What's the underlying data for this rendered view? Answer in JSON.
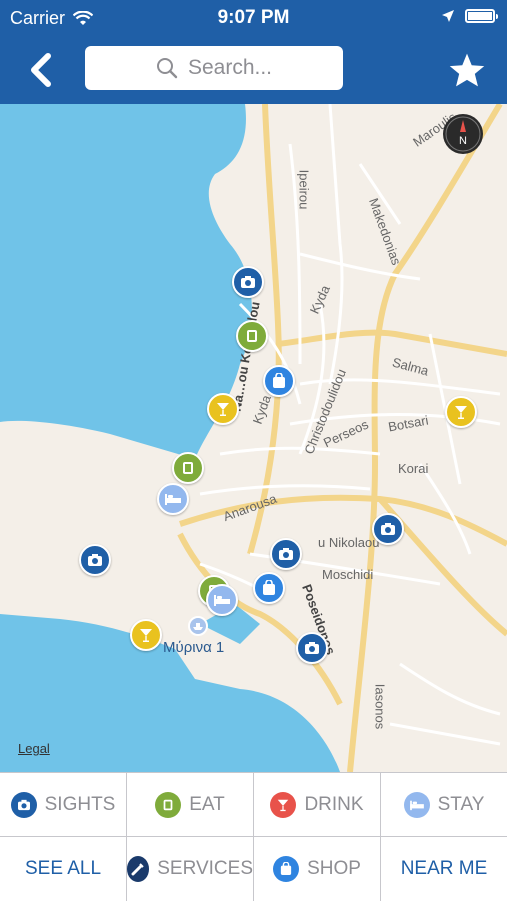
{
  "status_bar": {
    "carrier": "Carrier",
    "time": "9:07 PM"
  },
  "nav": {
    "search_placeholder": "Search..."
  },
  "map": {
    "legal": "Legal",
    "town_label": "Μύρινα 1",
    "street_labels": [
      "Ipeirou",
      "Makedonias",
      "Maroulis",
      "Kyda",
      "Kyda",
      "Salma",
      "Christodoulidou",
      "Perseos",
      "Botsari",
      "Korai",
      "Anarousa",
      "u Nikolaou",
      "Moschidi",
      "Poseidonos",
      "Iasonos",
      "Na…ou Ko…ndou"
    ]
  },
  "categories": [
    {
      "label": "SIGHTS",
      "icon": "camera-icon",
      "color": "#1f5fa7"
    },
    {
      "label": "EAT",
      "icon": "plate-icon",
      "color": "#7fab3b"
    },
    {
      "label": "DRINK",
      "icon": "cocktail-icon",
      "color": "#e8524a"
    },
    {
      "label": "STAY",
      "icon": "bed-icon",
      "color": "#93b8ee"
    },
    {
      "label": "SEE ALL",
      "icon": "",
      "color": "#1f5fa7"
    },
    {
      "label": "SERVICES",
      "icon": "tools-icon",
      "color": "#1a3a6b"
    },
    {
      "label": "SHOP",
      "icon": "bag-icon",
      "color": "#2f84e0"
    },
    {
      "label": "NEAR ME",
      "icon": "",
      "color": "#1f5fa7"
    }
  ]
}
